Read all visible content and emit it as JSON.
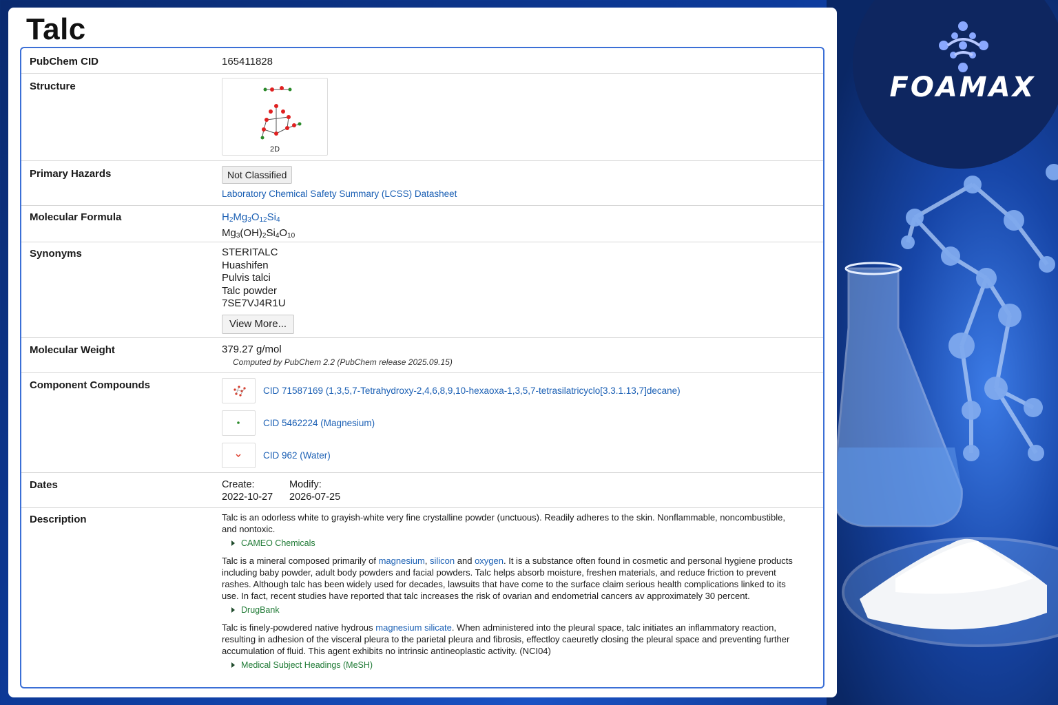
{
  "page": {
    "title": "Talc",
    "colors": {
      "accent": "#3b6fd6",
      "link": "#1a5fb4",
      "source": "#1f7a35",
      "background": "#0d3b9c"
    }
  },
  "brand": {
    "name": "FOAMAX",
    "icon": "molecule-logo-icon"
  },
  "rows": {
    "cid": {
      "label": "PubChem CID",
      "value": "165411828"
    },
    "structure": {
      "label": "Structure",
      "caption": "2D"
    },
    "hazards": {
      "label": "Primary Hazards",
      "badge": "Not Classified",
      "link": "Laboratory Chemical Safety Summary (LCSS) Datasheet"
    },
    "formula": {
      "label": "Molecular Formula"
    },
    "synonyms": {
      "label": "Synonyms",
      "items": [
        "STERITALC",
        "Huashifen",
        "Pulvis talci",
        "Talc powder",
        "7SE7VJ4R1U"
      ],
      "view_more": "View More..."
    },
    "weight": {
      "label": "Molecular Weight",
      "value": "379.27 g/mol",
      "note": "Computed by PubChem 2.2 (PubChem release 2025.09.15)"
    },
    "components": {
      "label": "Component Compounds",
      "items": [
        "CID 71587169 (1,3,5,7-Tetrahydroxy-2,4,6,8,9,10-hexaoxa-1,3,5,7-tetrasilatricyclo[3.3.1.13,7]decane)",
        "CID 5462224 (Magnesium)",
        "CID 962 (Water)"
      ]
    },
    "dates": {
      "label": "Dates",
      "create_label": "Create:",
      "create": "2022-10-27",
      "modify_label": "Modify:",
      "modify": "2026-07-25"
    },
    "description": {
      "label": "Description",
      "p1": "Talc is an odorless white to grayish-white very fine crystalline powder (unctuous). Readily adheres to the skin. Nonflammable, noncombustible, and nontoxic.",
      "s1": "CAMEO Chemicals",
      "p2_a": "Talc is a mineral composed primarily of ",
      "p2_l1": "magnesium",
      "p2_b": ", ",
      "p2_l2": "silicon",
      "p2_c": " and ",
      "p2_l3": "oxygen",
      "p2_d": ". It is a substance often found in cosmetic and personal hygiene products including baby powder, adult body powders and facial powders. Talc helps absorb moisture, freshen materials, and reduce friction to prevent rashes. Although talc has been widely used for decades, lawsuits that have come to the surface claim serious health complications linked to its use. In fact, recent studies have reported that talc increases the risk of ovarian and endometrial cancers av approximately 30 percent.",
      "s2": "DrugBank",
      "p3_a": "Talc is finely-powdered native hydrous ",
      "p3_l1": "magnesium silicate",
      "p3_b": ". When administered into the pleural space, talc initiates an inflammatory reaction, resulting in adhesion of the visceral pleura to the parietal pleura and fibrosis, effectloy caeuretly closing the pleural space and preventing further accumulation of fluid. This agent exhibits no intrinsic antineoplastic activity. (NCI04)",
      "s3": "Medical Subject Headings (MeSH)"
    }
  }
}
